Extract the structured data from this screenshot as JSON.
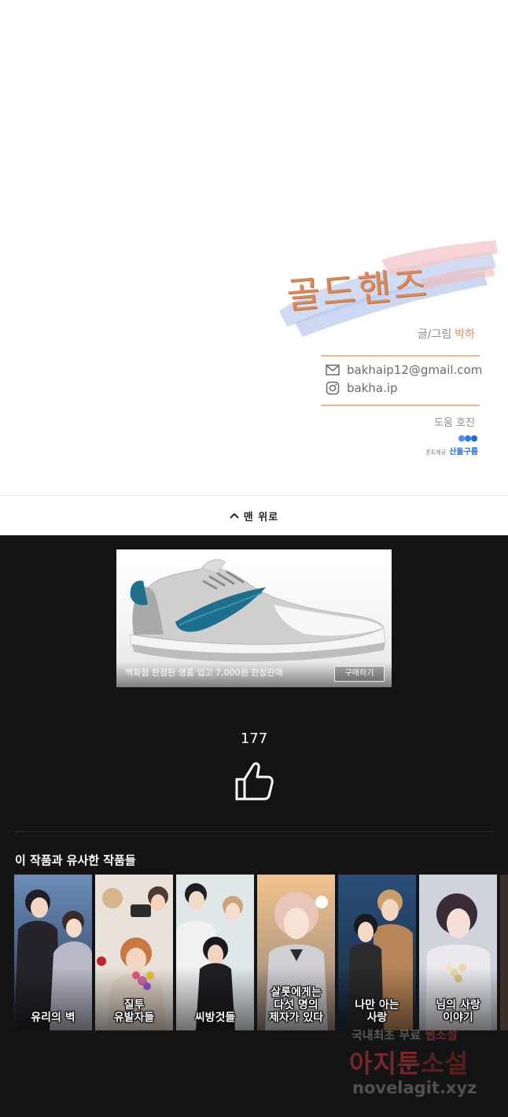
{
  "credits": {
    "logo_text": "골드핸즈",
    "author_label": "글/그림",
    "author_name": "박하",
    "email": "bakhaip12@gmail.com",
    "instagram": "bakha.ip",
    "help": "도움 호진",
    "font_credit_label": "폰트제공",
    "font_credit_name": "산돌구름"
  },
  "nav": {
    "back_to_top": "맨 위로"
  },
  "ad": {
    "text": "백화점 한정판 명품 입고 7,000원 한정판매",
    "button": "구매하기"
  },
  "likes": {
    "count": "177"
  },
  "similar": {
    "heading": "이 작품과 유사한 작품들",
    "items": [
      {
        "title": "유리의 벽"
      },
      {
        "title": "질투\n유발자들"
      },
      {
        "title": "씨방것들"
      },
      {
        "title": "살롯에게는\n다섯 명의\n제자가 있다"
      },
      {
        "title": "나만 아는\n사랑"
      },
      {
        "title": "님의 사랑\n이야기"
      }
    ]
  },
  "watermark": {
    "line1_a": "국내최초 무료 ",
    "line1_b": "웹소설",
    "line2_a": "아지툰",
    "line2_b": "소설",
    "line3": "novelagit.xyz"
  },
  "colors": {
    "accent_orange": "#de8a5e",
    "dark_bg": "#141414",
    "font_credit_blue": "#1f6fe0"
  }
}
